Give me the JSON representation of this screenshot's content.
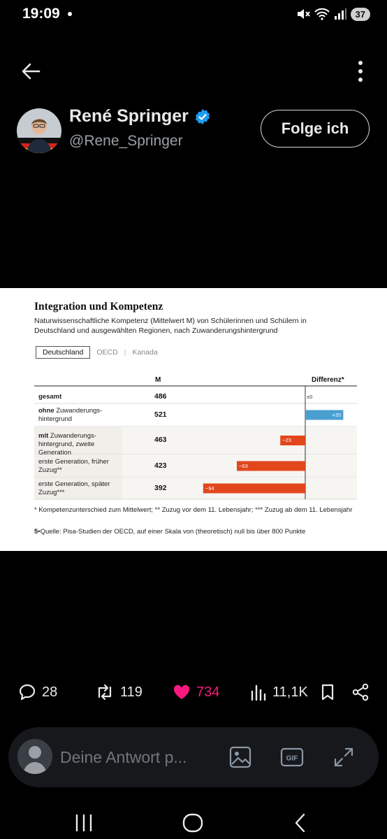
{
  "status_bar": {
    "time": "19:09",
    "battery": "37"
  },
  "profile": {
    "name": "René Springer",
    "handle": "@Rene_Springer",
    "follow_label": "Folge ich"
  },
  "media": {
    "title": "Integration und Kompetenz",
    "subtitle": "Naturwissenschaftliche Kompetenz (Mittelwert M) von Schülerinnen und Schülern in Deutschland und ausgewählten Regionen, nach Zuwanderungshintergrund",
    "tabs": [
      "Deutschland",
      "OECD",
      "Kanada"
    ],
    "col_m": "M",
    "col_diff": "Differenz*",
    "zero_label": "±0",
    "rows": [
      {
        "bold": "gesamt",
        "rest": "",
        "value": "486",
        "diff_label": ""
      },
      {
        "bold": "ohne",
        "rest": " Zuwanderungs-hintergrund",
        "value": "521",
        "diff_label": "+35"
      },
      {
        "bold": "mit",
        "rest": " Zuwanderungs-hintergrund, zweite Generation",
        "value": "463",
        "diff_label": "−23"
      },
      {
        "bold": "",
        "rest": "erste Generation, früher Zuzug**",
        "value": "423",
        "diff_label": "−63"
      },
      {
        "bold": "",
        "rest": "erste Generation, später Zuzug***",
        "value": "392",
        "diff_label": "−94"
      }
    ],
    "footnote": "* Kompetenzunterschied zum Mittelwert; ** Zuzug vor dem 11. Lebensjahr; *** Zuzug ab dem 11. Lebensjahr",
    "source_num": "5",
    "source_text": "•Quelle: Pisa-Studien der OECD, auf einer Skala von (theoretisch) null bis über 800 Punkte",
    "colors": {
      "positive": "#4a9fd1",
      "negative": "#e2461b"
    }
  },
  "chart_data": {
    "type": "bar",
    "title": "Integration und Kompetenz",
    "subtitle": "Naturwissenschaftliche Kompetenz (Mittelwert M) von Schülerinnen und Schülern in Deutschland und ausgewählten Regionen, nach Zuwanderungshintergrund",
    "categories": [
      "gesamt",
      "ohne Zuwanderungshintergrund",
      "mit Zuwanderungshintergrund, zweite Generation",
      "erste Generation, früher Zuzug**",
      "erste Generation, später Zuzug***"
    ],
    "series": [
      {
        "name": "M",
        "values": [
          486,
          521,
          463,
          423,
          392
        ]
      },
      {
        "name": "Differenz*",
        "values": [
          0,
          35,
          -23,
          -63,
          -94
        ]
      }
    ],
    "diff_range": [
      -100,
      50
    ]
  },
  "actions": {
    "replies": "28",
    "reposts": "119",
    "likes": "734",
    "views": "11,1K"
  },
  "reply": {
    "placeholder": "Deine Antwort p..."
  },
  "icons": {
    "like_color": "#f91880",
    "verified_color": "#1d9bf0"
  }
}
